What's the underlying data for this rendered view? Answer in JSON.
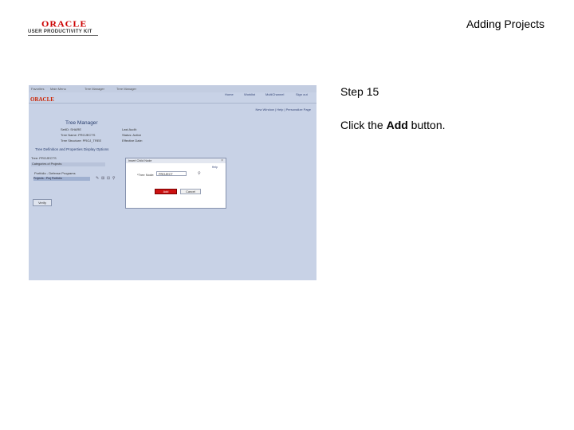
{
  "logo": {
    "brand": "ORACLE",
    "tagline": "USER PRODUCTIVITY KIT"
  },
  "slide": {
    "title": "Adding Projects",
    "step": "Step 15",
    "instruction_prefix": "Click the ",
    "instruction_bold": "Add",
    "instruction_suffix": " button."
  },
  "screenshot": {
    "nav": [
      "Favorites",
      "Main Menu",
      "Tree Manager",
      "Tree Manager"
    ],
    "brand": "ORACLE",
    "header_links": [
      "Home",
      "Worklist",
      "MultiChannel",
      "Sign out"
    ],
    "small_links": "New Window | Help | Personalize Page",
    "page_title": "Tree Manager",
    "fields_left": [
      "SetID:  SHARE",
      "Tree Name:  PROJECTS",
      "Tree Structure:  PROJ_TREE"
    ],
    "fields_right": [
      "Last Audit:",
      "Status:  Active",
      "Effective Date:"
    ],
    "section_bar": "Tree Definition and Properties    Display Options",
    "row1": "Tree:  PROJECTS",
    "row2": "Categories of Projects",
    "row3": "Portfolio - Defense Programs",
    "row4": "Projects - Proj Portfolio",
    "verify_label": "Verify",
    "modal": {
      "title": "Insert Child Node",
      "help": "Help",
      "close": "×",
      "field_label": "*Tree Node:",
      "field_value": "PROJECT",
      "add_label": "Add",
      "cancel_label": "Cancel"
    }
  }
}
